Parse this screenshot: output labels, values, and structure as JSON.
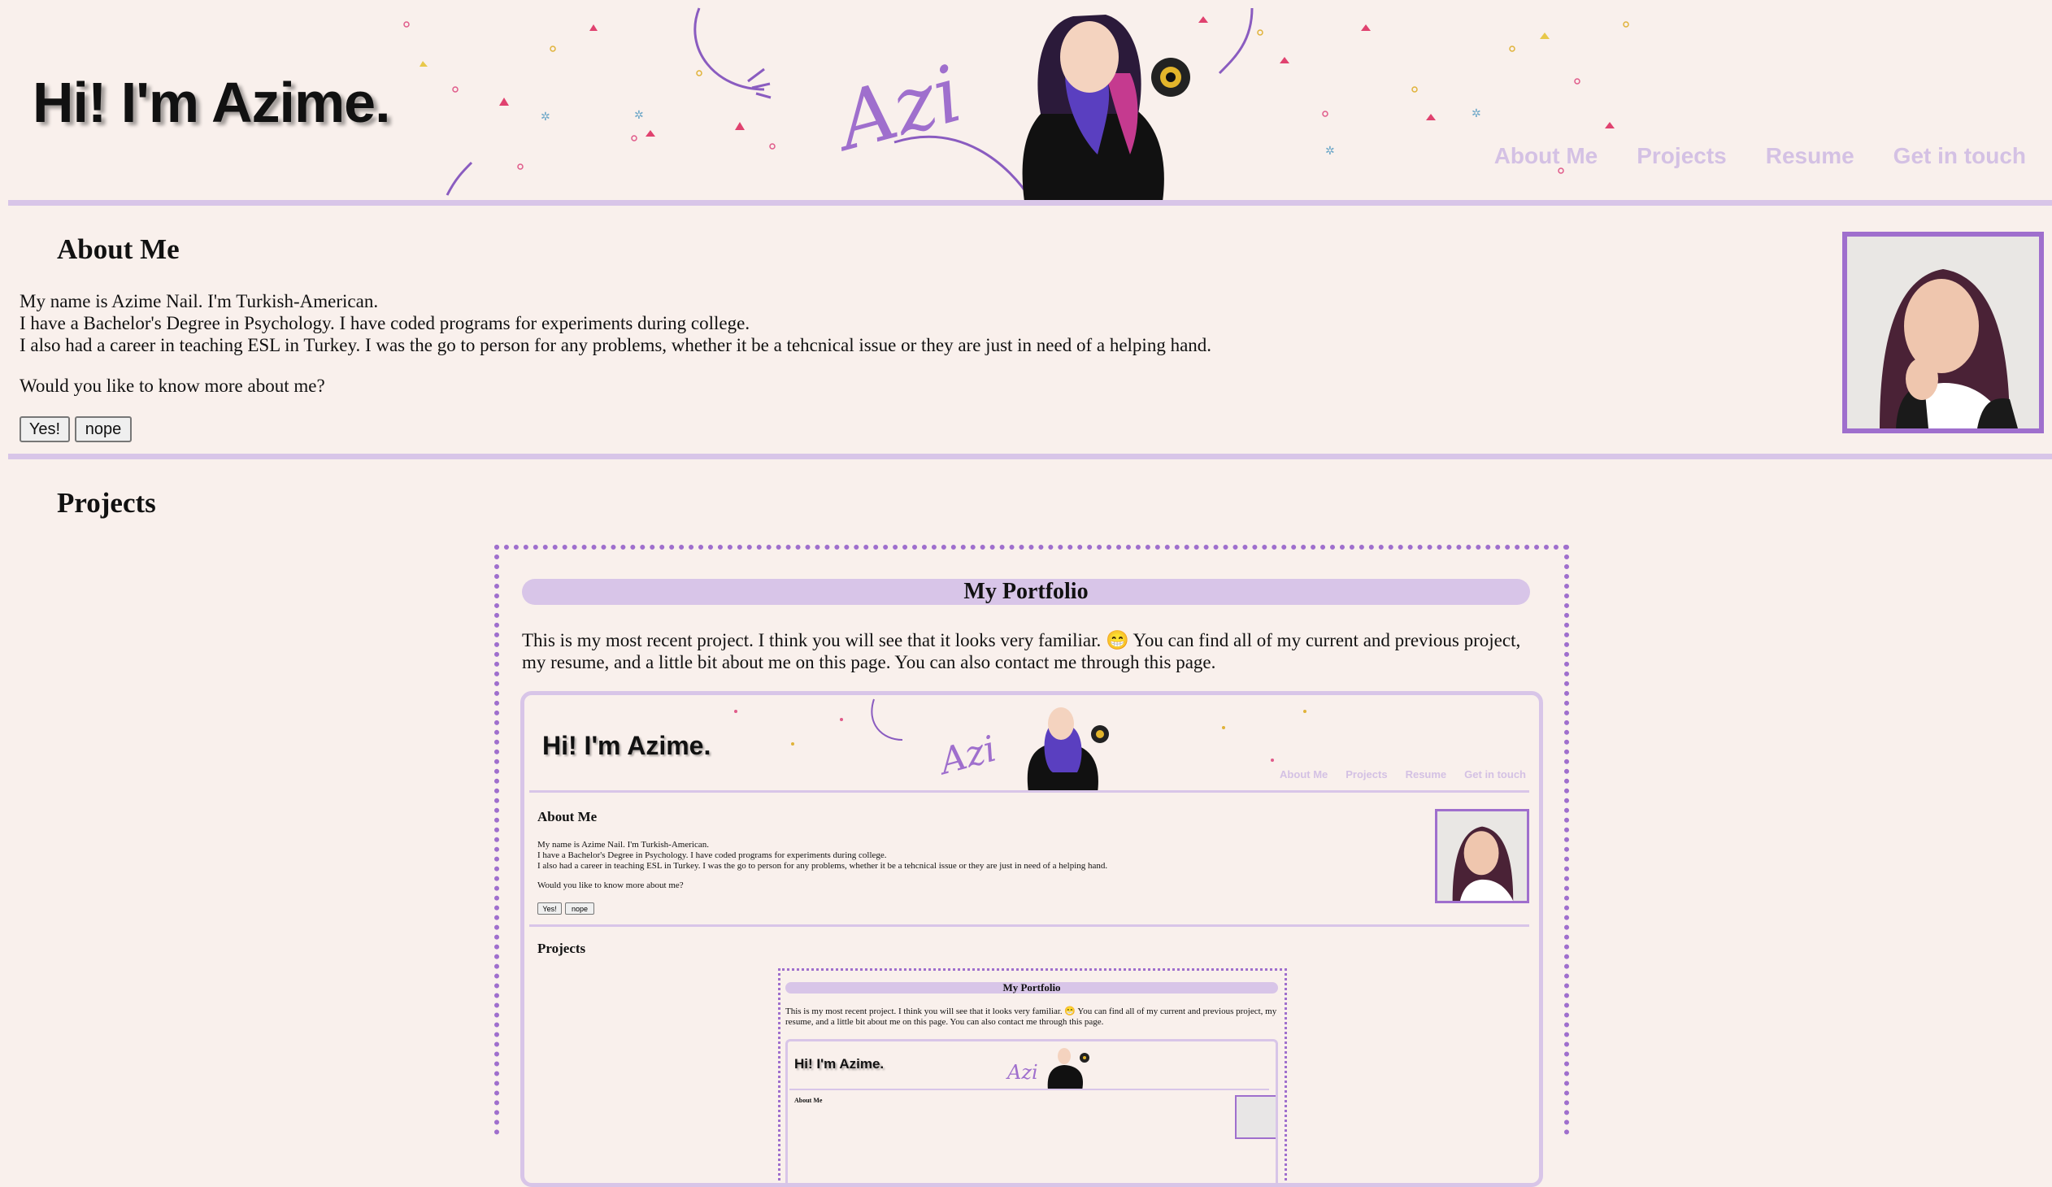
{
  "header": {
    "title": "Hi! I'm Azime.",
    "banner_signature": "Azi",
    "nav": [
      "About Me",
      "Projects",
      "Resume",
      "Get in touch"
    ]
  },
  "about": {
    "heading": "About Me",
    "lines": [
      "My name is Azime Nail. I'm Turkish-American.",
      "I have a Bachelor's Degree in Psychology. I have coded programs for experiments during college.",
      "I also had a career in teaching ESL in Turkey. I was the go to person for any problems, whether it be a tehcnical issue or they are just in need of a helping hand."
    ],
    "question": "Would you like to know more about me?",
    "yes_label": "Yes!",
    "nope_label": "nope"
  },
  "projects": {
    "heading": "Projects",
    "card": {
      "title": "My Portfolio",
      "description": "This is my most recent project. I think you will see that it looks very familiar. 😁 You can find all of my current and previous project, my resume, and a little bit about me on this page. You can also contact me through this page."
    }
  },
  "colors": {
    "background": "#f9f0ec",
    "accent_light": "#d8c5e8",
    "accent": "#9f6fcd",
    "nav_text": "#d4c1e4"
  }
}
